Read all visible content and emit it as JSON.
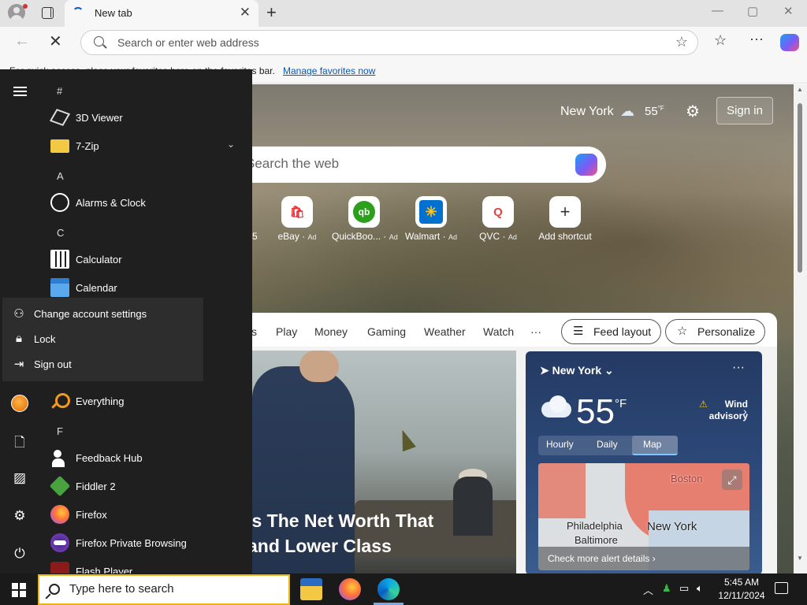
{
  "browser": {
    "tab_title": "New tab",
    "tab_close": "✕",
    "new_tab": "+",
    "win_controls": [
      "—",
      "▢",
      "✕"
    ],
    "address_placeholder": "Search or enter web address",
    "favorites_message": "For quick access, place your favorites here on the favorites bar.",
    "favorites_link": "Manage favorites now",
    "toolbar_icons": [
      "back-icon",
      "stop-icon",
      "favorites-star-icon",
      "favorites-icon",
      "more-icon",
      "copilot-icon"
    ]
  },
  "newtab": {
    "location": "New York",
    "temp": "55",
    "temp_unit": "°F",
    "sign_in": "Sign in",
    "search_placeholder": "Search the web",
    "partial_text": "5",
    "shortcuts": [
      {
        "label": "eBay",
        "ad": "Ad",
        "glyph": "🛍"
      },
      {
        "label": "QuickBoo...",
        "ad": "Ad",
        "glyph": "qb"
      },
      {
        "label": "Walmart",
        "ad": "Ad",
        "glyph": "✳"
      },
      {
        "label": "QVC",
        "ad": "Ad",
        "glyph": "Q"
      },
      {
        "label": "Add shortcut",
        "ad": "",
        "glyph": "+"
      }
    ],
    "feed_tabs": [
      "s",
      "Play",
      "Money",
      "Gaming",
      "Weather",
      "Watch",
      "···"
    ],
    "feed_layout": "Feed layout",
    "personalize": "Personalize",
    "news_title_line1": "'s The Net Worth That",
    "news_title_line2": "and Lower Class"
  },
  "weather": {
    "location": "New York",
    "more": "···",
    "temp": "55",
    "unit": "°F",
    "alert_line1": "Wind",
    "alert_line2": "advisory",
    "tabs": [
      "Hourly",
      "Daily",
      "Map"
    ],
    "active_tab": "Map",
    "map_labels": [
      "Boston",
      "Philadelphia",
      "New York",
      "Baltimore"
    ],
    "map_footer": "Check more alert details ›"
  },
  "start_menu": {
    "letters": [
      "#",
      "A",
      "C",
      "F"
    ],
    "apps": [
      {
        "label": "3D Viewer"
      },
      {
        "label": "7-Zip"
      },
      {
        "label": "Alarms & Clock"
      },
      {
        "label": "Calculator"
      },
      {
        "label": "Calendar"
      },
      {
        "label": "Everything"
      },
      {
        "label": "Feedback Hub"
      },
      {
        "label": "Fiddler 2"
      },
      {
        "label": "Firefox"
      },
      {
        "label": "Firefox Private Browsing"
      },
      {
        "label": "Flash Player"
      }
    ],
    "account_menu": [
      "Change account settings",
      "Lock",
      "Sign out"
    ],
    "rail_icons": [
      "user-avatar-icon",
      "documents-icon",
      "pictures-icon",
      "settings-icon",
      "power-icon"
    ]
  },
  "taskbar": {
    "search_placeholder": "Type here to search",
    "pinned": [
      "file-explorer-icon",
      "firefox-icon",
      "edge-icon"
    ],
    "time": "5:45 AM",
    "date": "12/11/2024"
  }
}
